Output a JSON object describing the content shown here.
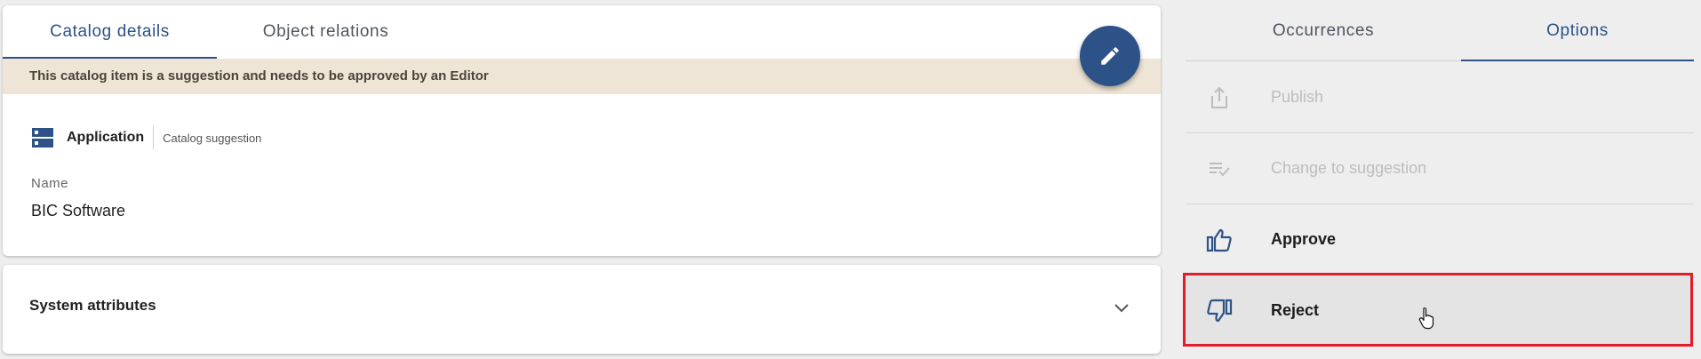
{
  "left": {
    "tabs": [
      {
        "label": "Catalog details",
        "active": true
      },
      {
        "label": "Object relations",
        "active": false
      }
    ],
    "banner": "This catalog item is a suggestion and needs to be approved by an Editor",
    "item": {
      "type_label": "Application",
      "type_sub": "Catalog suggestion",
      "icon": "application-server-icon"
    },
    "field": {
      "label": "Name",
      "value": "BIC Software"
    },
    "system_attributes": {
      "title": "System attributes",
      "expanded": false
    }
  },
  "right": {
    "tabs": [
      {
        "label": "Occurrences",
        "active": false
      },
      {
        "label": "Options",
        "active": true
      }
    ],
    "options": [
      {
        "label": "Publish",
        "icon": "share-upload-icon",
        "enabled": false
      },
      {
        "label": "Change to suggestion",
        "icon": "list-check-icon",
        "enabled": false
      },
      {
        "label": "Approve",
        "icon": "thumbs-up-icon",
        "enabled": true
      },
      {
        "label": "Reject",
        "icon": "thumbs-down-icon",
        "enabled": true,
        "highlighted": true
      }
    ]
  },
  "colors": {
    "accent": "#2c5287",
    "banner_bg": "#efe5d6",
    "highlight": "#e11d2a",
    "background": "#eeeeee"
  }
}
